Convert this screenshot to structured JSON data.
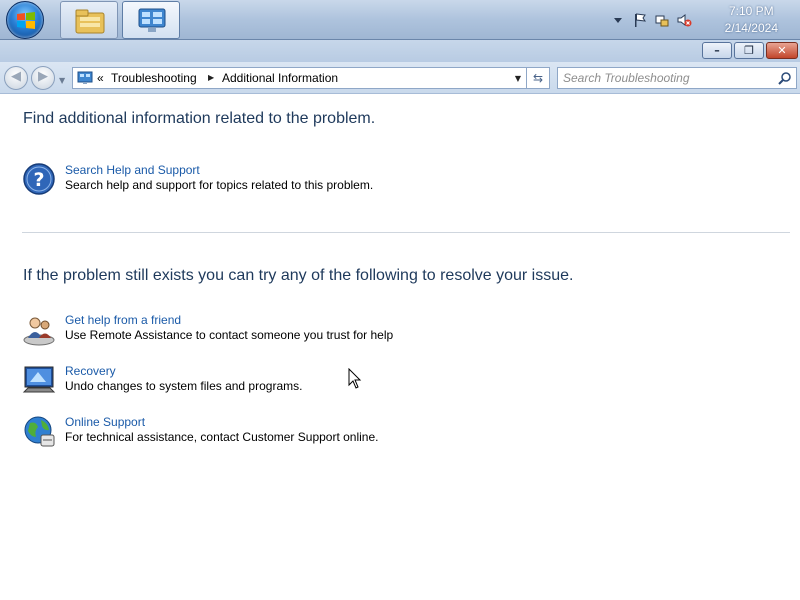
{
  "taskbar": {
    "start_icon": "windows-start-orb",
    "pinned": [
      {
        "name": "explorer-folder-icon"
      },
      {
        "name": "control-panel-icon"
      }
    ],
    "tray_icons": [
      "show-hidden-icons-arrow",
      "action-center-flag-icon",
      "network-icon",
      "volume-muted-icon"
    ],
    "clock": {
      "time": "7:10 PM",
      "date": "2/14/2024"
    }
  },
  "window": {
    "caption_buttons": {
      "minimize": "–",
      "maximize": "❐",
      "close": "✕"
    }
  },
  "address_bar": {
    "overflow": "«",
    "breadcrumb": [
      "Troubleshooting",
      "Additional Information"
    ],
    "search_placeholder": "Search Troubleshooting"
  },
  "content": {
    "section1": {
      "heading": "Find additional information related to the problem.",
      "items": [
        {
          "icon": "help-question-icon",
          "link": "Search Help and Support",
          "desc": "Search help and support for topics related to this problem."
        }
      ]
    },
    "section2": {
      "heading": "If the problem still exists you can try any of the following to resolve your issue.",
      "items": [
        {
          "icon": "remote-assistance-icon",
          "link": "Get help from a friend",
          "desc": "Use Remote Assistance to contact someone you trust for help"
        },
        {
          "icon": "recovery-icon",
          "link": "Recovery",
          "desc": "Undo changes to system files and programs."
        },
        {
          "icon": "online-support-globe-icon",
          "link": "Online Support",
          "desc": "For technical assistance, contact Customer Support online."
        }
      ]
    }
  },
  "colors": {
    "heading": "#1e395b",
    "link": "#1a5aa8",
    "taskbar": "#aec3dd"
  }
}
